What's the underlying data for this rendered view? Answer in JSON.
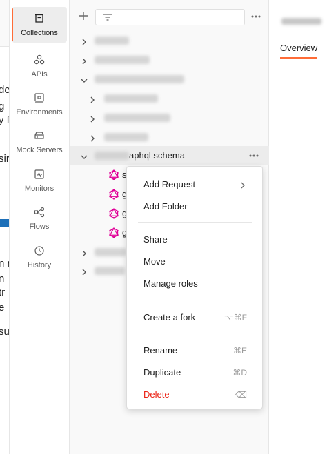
{
  "left_strip": {
    "fragments": [
      "de",
      "g",
      "y f",
      "sir",
      "n r",
      "n",
      "tr",
      "e",
      "su"
    ]
  },
  "rail": {
    "items": [
      {
        "label": "Collections",
        "icon": "collections-icon",
        "active": true
      },
      {
        "label": "APIs",
        "icon": "apis-icon"
      },
      {
        "label": "Environments",
        "icon": "environments-icon"
      },
      {
        "label": "Mock Servers",
        "icon": "mock-servers-icon"
      },
      {
        "label": "Monitors",
        "icon": "monitors-icon"
      },
      {
        "label": "Flows",
        "icon": "flows-icon"
      },
      {
        "label": "History",
        "icon": "history-icon"
      }
    ]
  },
  "tree": {
    "schema_row_suffix": "aphql schema",
    "request_fragments": [
      "s",
      "g",
      "g",
      "g"
    ]
  },
  "right_pane": {
    "tab": "Overview"
  },
  "context_menu": {
    "items": [
      {
        "label": "Add Request",
        "shortcut": "",
        "submenu": true
      },
      {
        "label": "Add Folder",
        "shortcut": ""
      },
      {
        "label": "Share",
        "shortcut": ""
      },
      {
        "label": "Move",
        "shortcut": ""
      },
      {
        "label": "Manage roles",
        "shortcut": ""
      },
      {
        "label": "Create a fork",
        "shortcut": "⌥⌘F"
      },
      {
        "label": "Rename",
        "shortcut": "⌘E"
      },
      {
        "label": "Duplicate",
        "shortcut": "⌘D"
      },
      {
        "label": "Delete",
        "shortcut": "⌫",
        "danger": true
      }
    ]
  },
  "colors": {
    "accent": "#ff6c37",
    "danger": "#eb2013",
    "graphql": "#e10098"
  }
}
